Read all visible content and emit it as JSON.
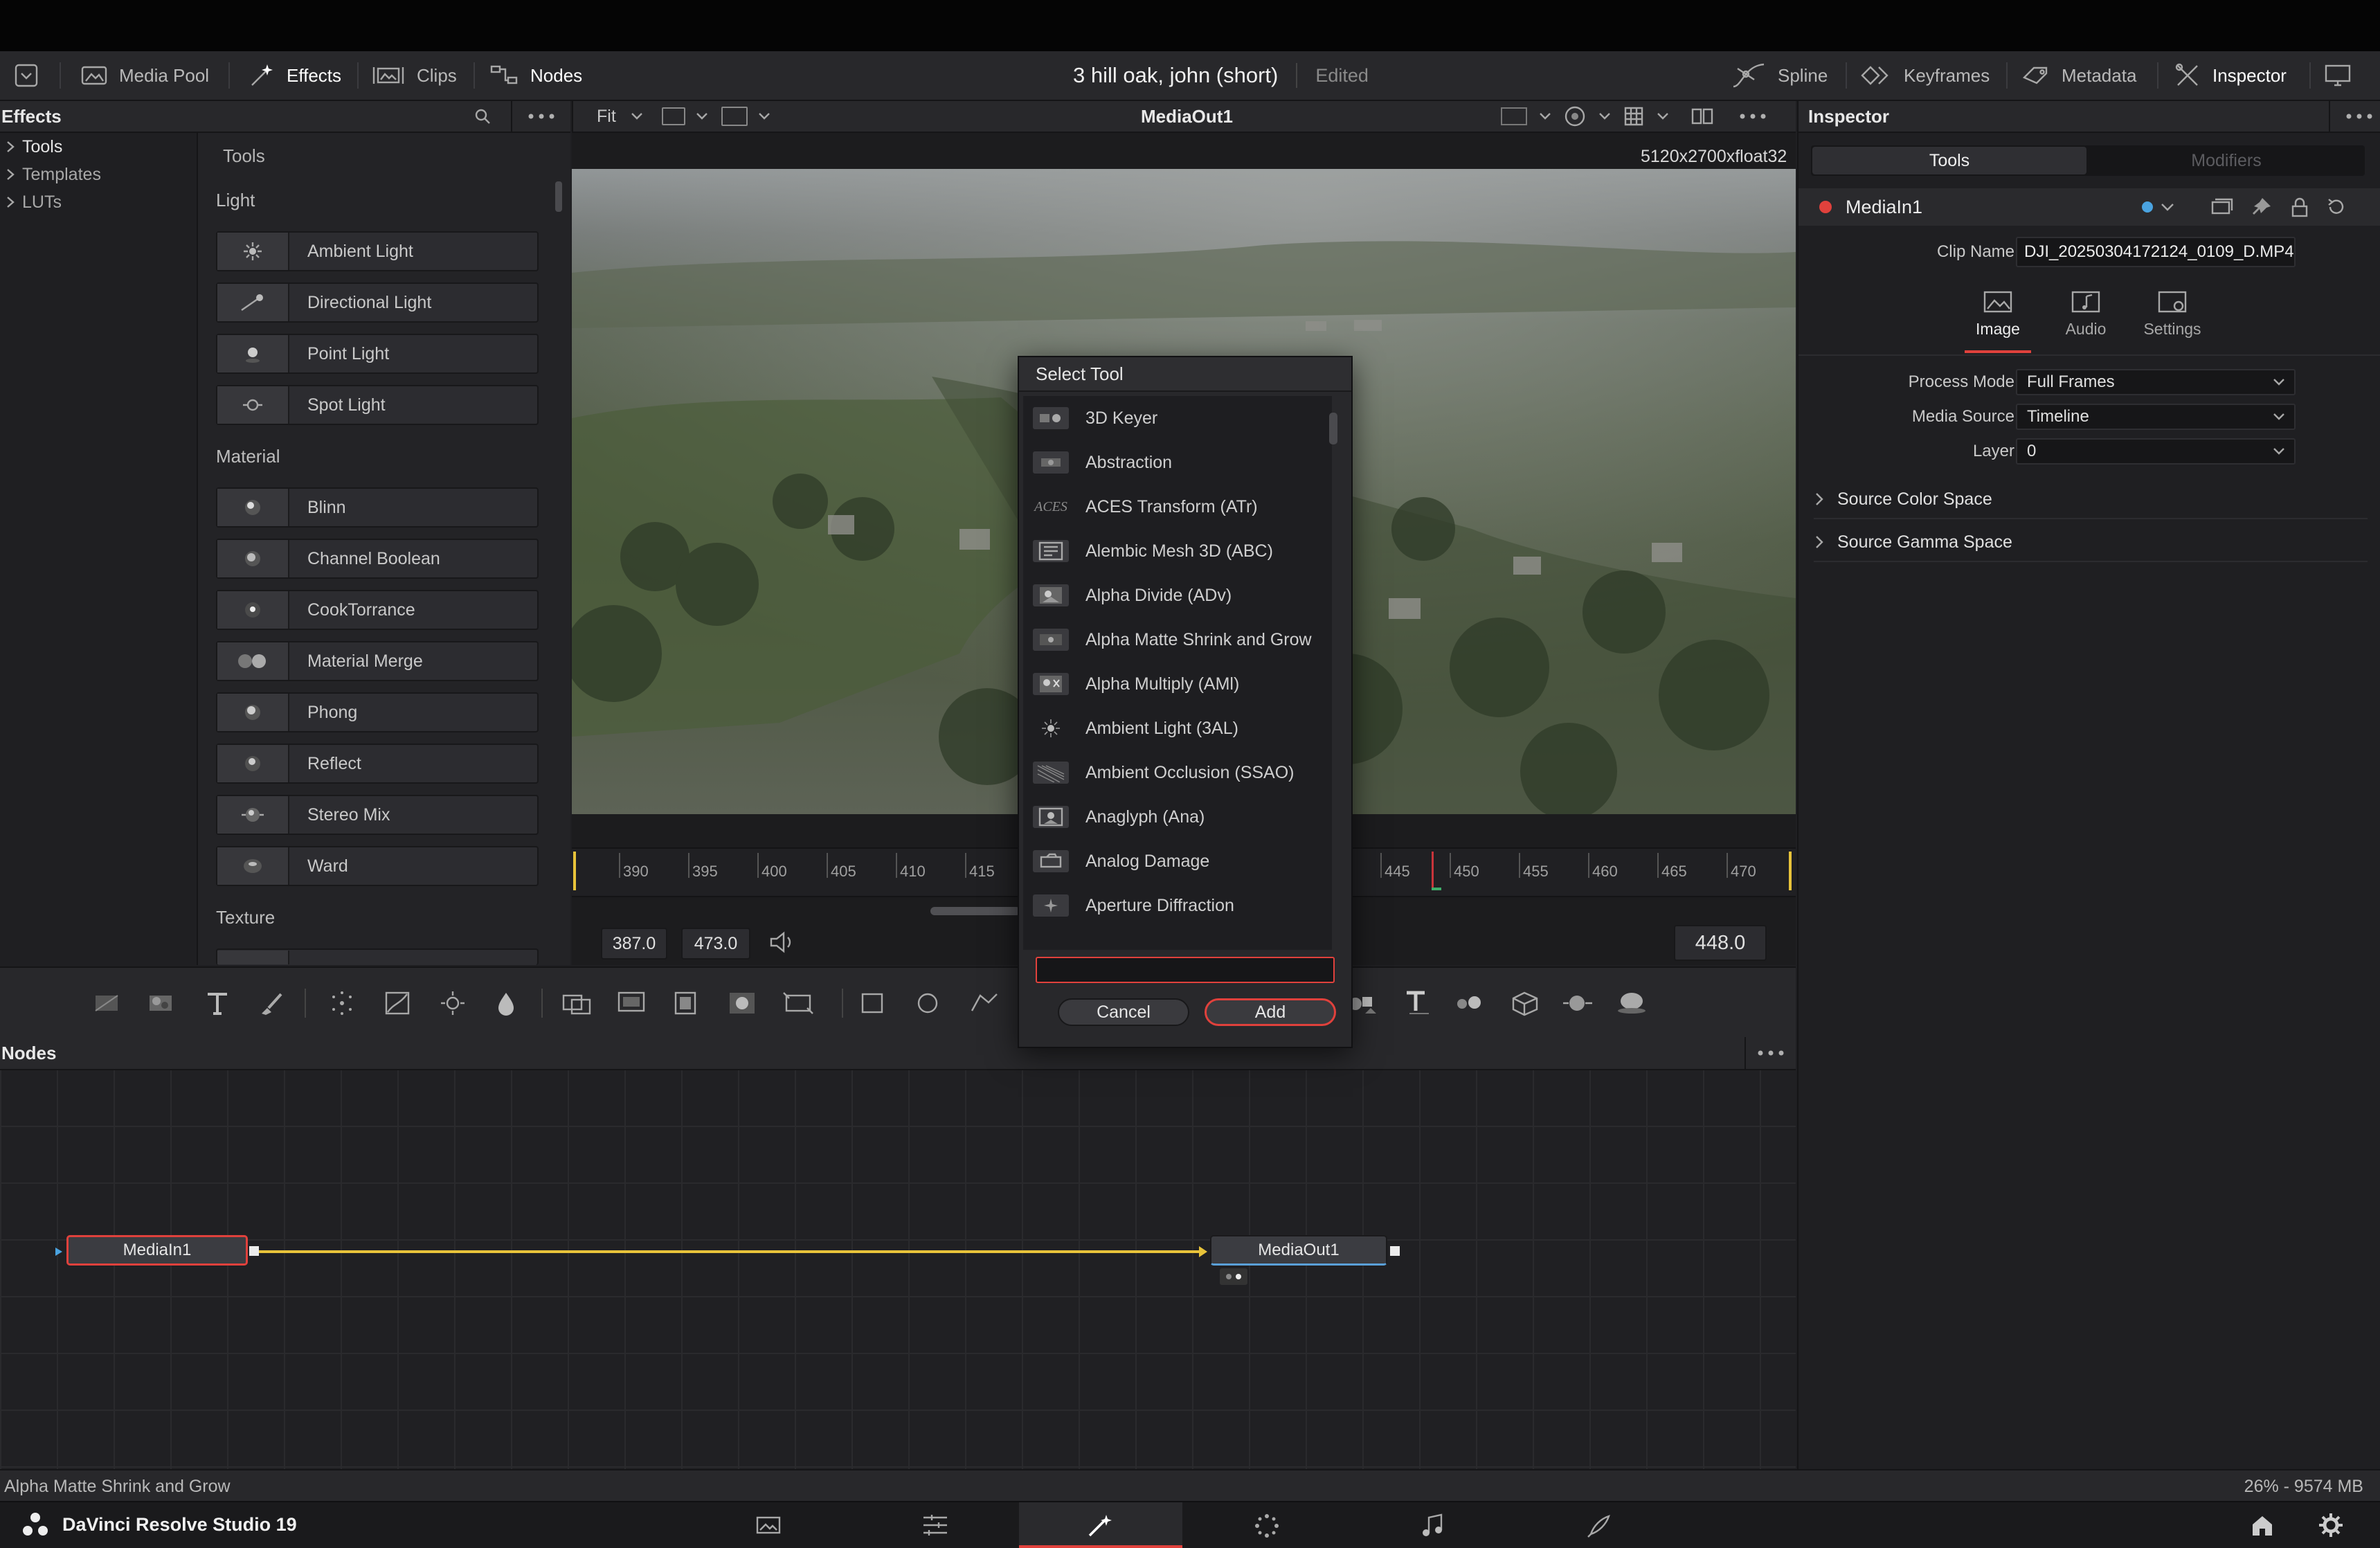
{
  "topbar": {
    "media_pool": "Media Pool",
    "effects": "Effects",
    "clips": "Clips",
    "nodes": "Nodes",
    "project_title": "3 hill oak, john (short)",
    "project_status": "Edited",
    "spline": "Spline",
    "keyframes": "Keyframes",
    "metadata": "Metadata",
    "inspector": "Inspector"
  },
  "effects_panel": {
    "title": "Effects",
    "tree": [
      {
        "label": "Tools"
      },
      {
        "label": "Templates"
      },
      {
        "label": "LUTs"
      }
    ],
    "list_title": "Tools",
    "categories": {
      "light": "Light",
      "material": "Material",
      "texture": "Texture"
    },
    "light_items": [
      "Ambient Light",
      "Directional Light",
      "Point Light",
      "Spot Light"
    ],
    "material_items": [
      "Blinn",
      "Channel Boolean",
      "CookTorrance",
      "Material Merge",
      "Phong",
      "Reflect",
      "Stereo Mix",
      "Ward"
    ]
  },
  "viewer": {
    "zoom": "Fit",
    "title": "MediaOut1",
    "resolution": "5120x2700xfloat32",
    "ruler_ticks": [
      "390",
      "395",
      "400",
      "405",
      "410",
      "415",
      "445",
      "450",
      "455",
      "460",
      "465",
      "470"
    ],
    "in_point": "387.0",
    "out_point": "473.0",
    "current_frame": "448.0"
  },
  "nodes_panel": {
    "title": "Nodes",
    "node_in": "MediaIn1",
    "node_out": "MediaOut1"
  },
  "inspector": {
    "title": "Inspector",
    "tab_tools": "Tools",
    "tab_modifiers": "Modifiers",
    "node_name": "MediaIn1",
    "clip_name_label": "Clip Name",
    "clip_name_value": "DJI_20250304172124_0109_D.MP4",
    "subtabs": {
      "image": "Image",
      "audio": "Audio",
      "settings": "Settings"
    },
    "process_mode_label": "Process Mode",
    "process_mode_value": "Full Frames",
    "media_source_label": "Media Source",
    "media_source_value": "Timeline",
    "layer_label": "Layer",
    "layer_value": "0",
    "source_color_space": "Source Color Space",
    "source_gamma_space": "Source Gamma Space"
  },
  "dialog": {
    "title": "Select Tool",
    "items": [
      "3D Keyer",
      "Abstraction",
      "ACES Transform (ATr)",
      "Alembic Mesh 3D (ABC)",
      "Alpha Divide (ADv)",
      "Alpha Matte Shrink and Grow",
      "Alpha Multiply (AMl)",
      "Ambient Light (3AL)",
      "Ambient Occlusion (SSAO)",
      "Anaglyph (Ana)",
      "Analog Damage",
      "Aperture Diffraction"
    ],
    "search_value": "",
    "cancel": "Cancel",
    "add": "Add"
  },
  "status": {
    "hint": "Alpha Matte Shrink and Grow",
    "memory": "26% - 9574 MB",
    "app_name": "DaVinci Resolve Studio 19"
  },
  "colors": {
    "accent_red": "#e0413c",
    "connector_yellow": "#e8c33a",
    "playhead": "#c8343a"
  }
}
